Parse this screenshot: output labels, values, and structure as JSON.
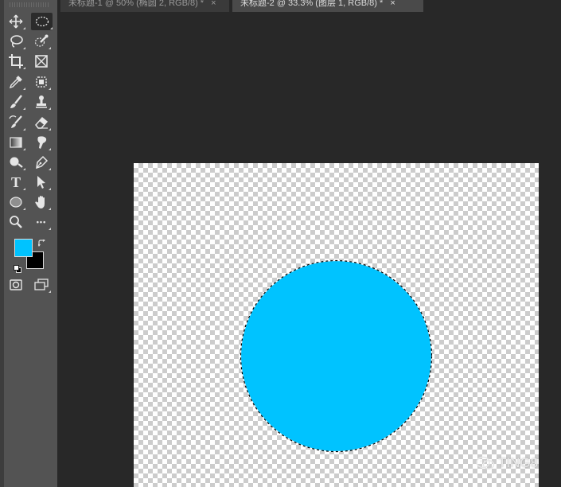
{
  "tabs": [
    {
      "label": "未标题-1 @ 50% (椭圆 2, RGB/8) *",
      "close": "×",
      "active": false
    },
    {
      "label": "未标题-2 @ 33.3% (图层 1, RGB/8) *",
      "close": "×",
      "active": true
    }
  ],
  "toolbar": {
    "type_tool_glyph": "T",
    "more_tools_glyph": "•••"
  },
  "colors": {
    "foreground": "#00c3ff",
    "background": "#000000",
    "shape_fill": "#00c3ff"
  },
  "watermark": {
    "text": "TING8"
  }
}
